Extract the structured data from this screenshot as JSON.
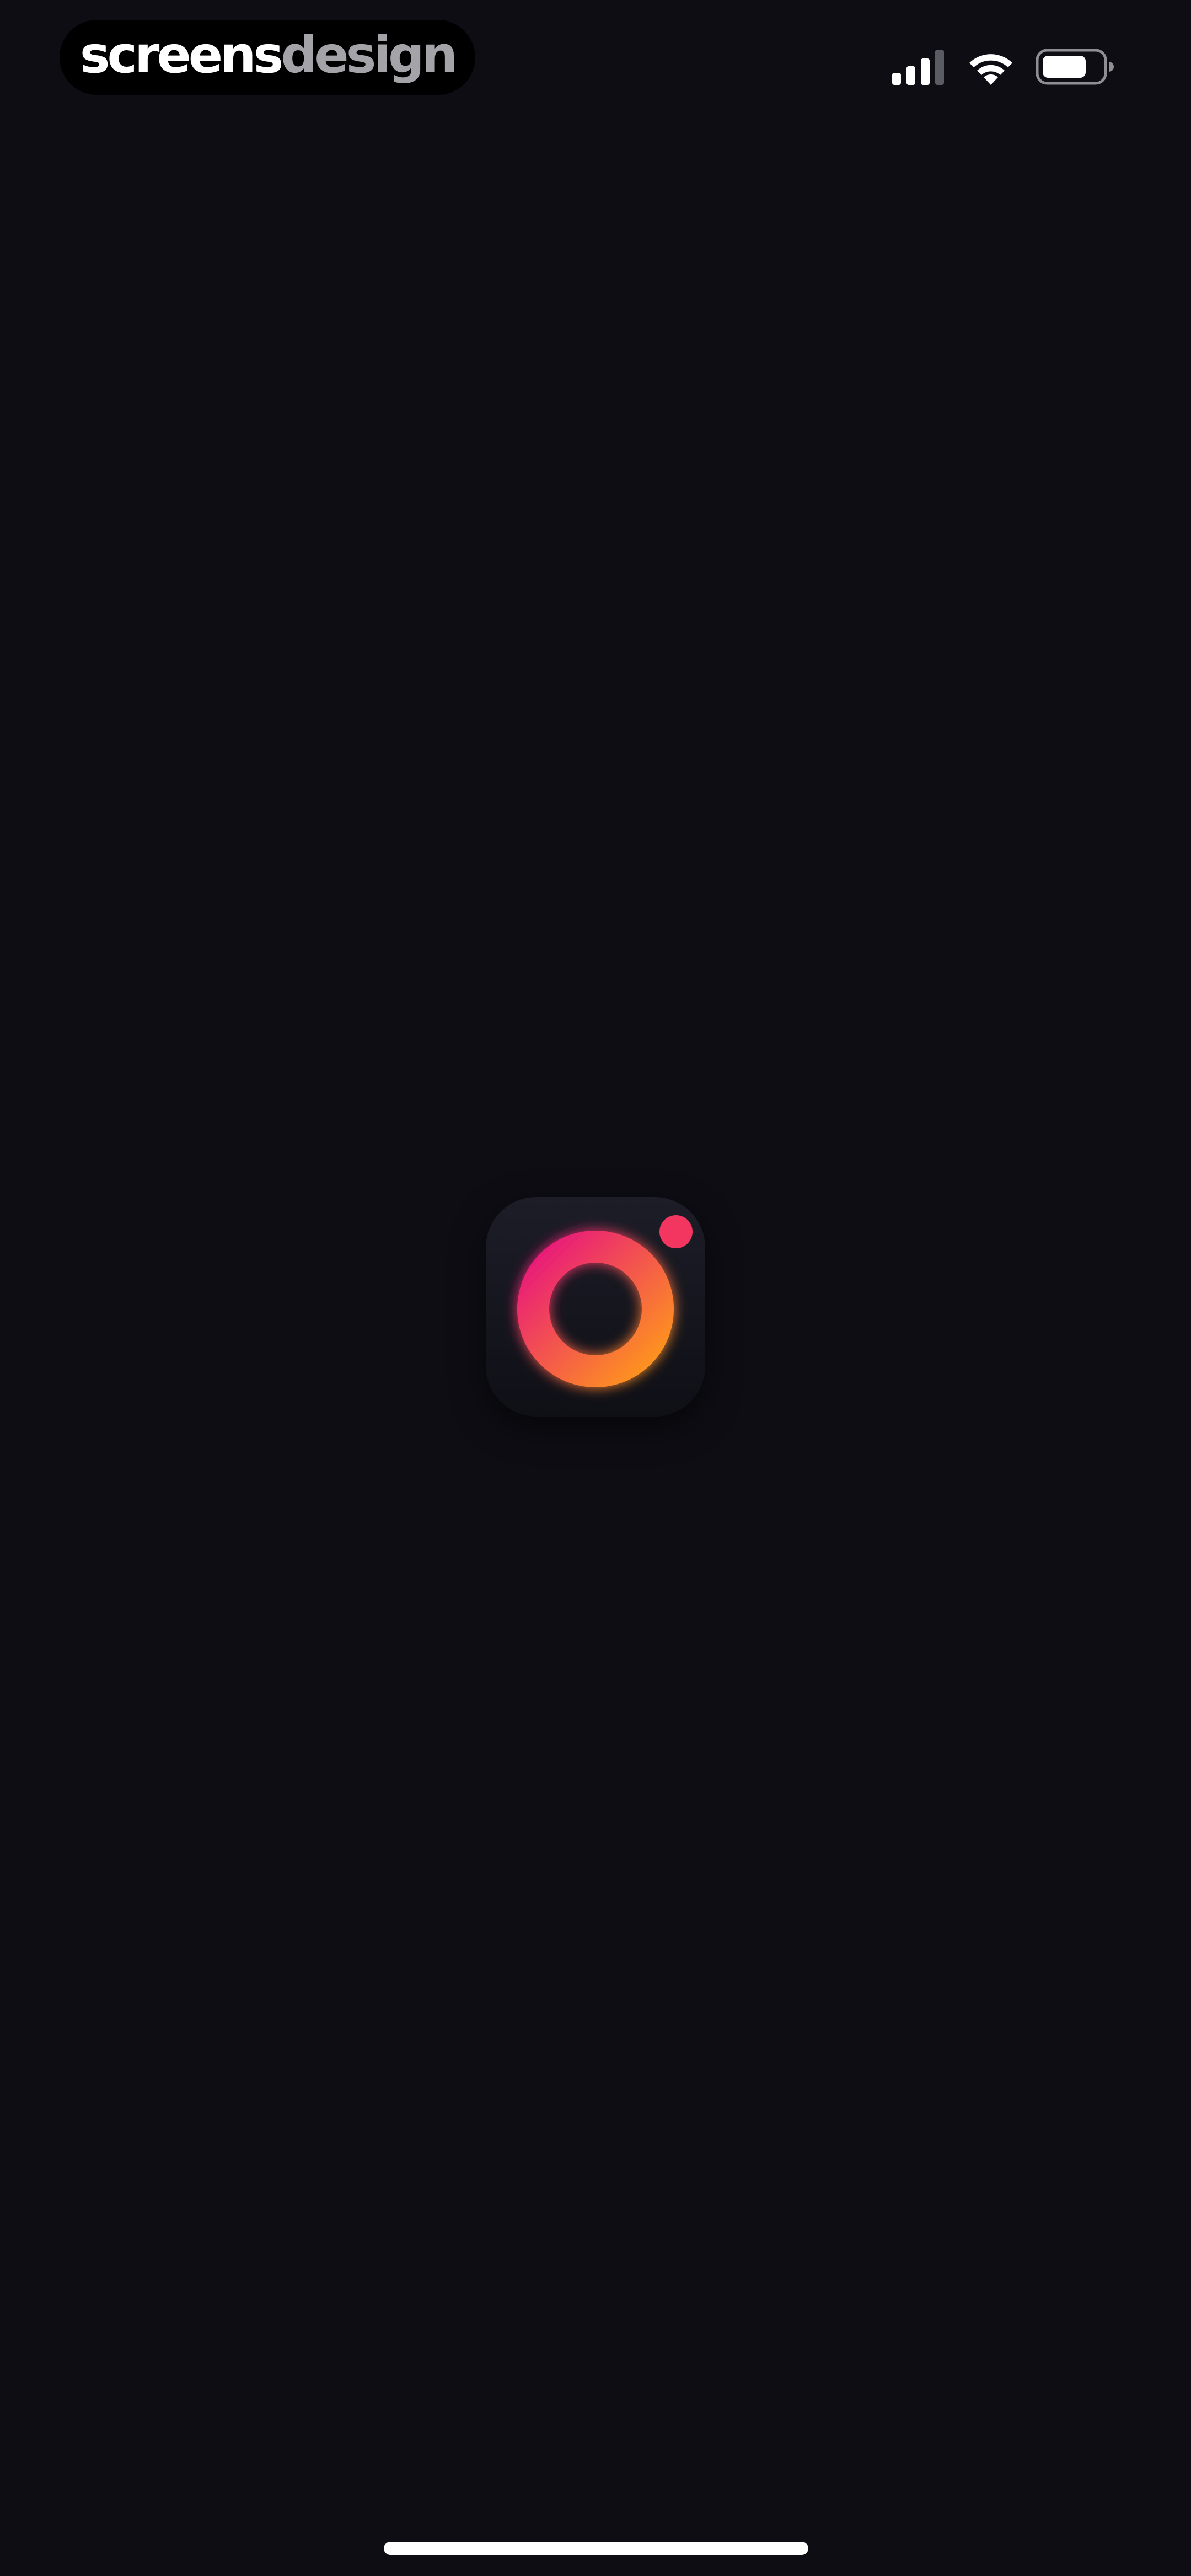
{
  "watermark": {
    "part1": "screens",
    "part2": "design"
  },
  "status_bar": {
    "cellular_icon": "cellular-signal-icon",
    "wifi_icon": "wifi-icon",
    "battery_icon": "battery-icon"
  },
  "app_icon": {
    "icon": "camera-ring-logo-icon",
    "colors": {
      "ring_start": "#e8157e",
      "ring_end": "#ff9a1a",
      "dot": "#f2365f",
      "background": "#15151e"
    }
  },
  "colors": {
    "screen_background": "#0e0d14",
    "home_indicator": "#ffffff"
  }
}
